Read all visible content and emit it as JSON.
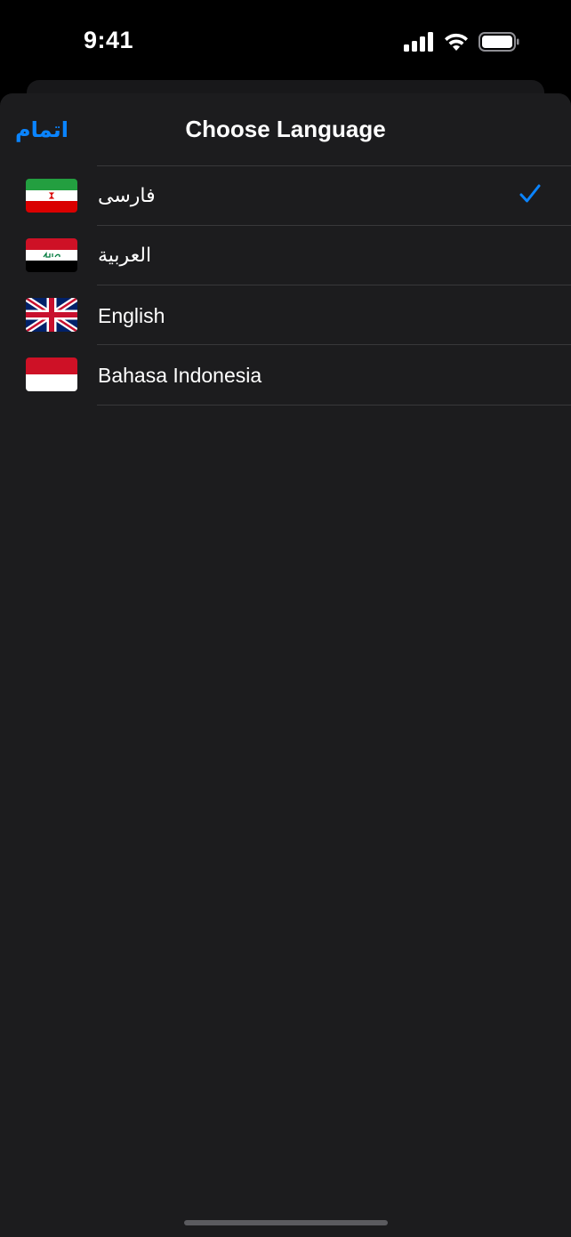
{
  "status_bar": {
    "time": "9:41",
    "icons": [
      "cellular-signal-icon",
      "wifi-icon",
      "battery-icon"
    ]
  },
  "sheet": {
    "title": "Choose Language",
    "done_label": "اتمام",
    "accent_color": "#0a84ff",
    "background_color": "#1c1c1e"
  },
  "languages": [
    {
      "label": "فارسی",
      "flag": "iran-flag-icon",
      "selected": true
    },
    {
      "label": "العربية",
      "flag": "iraq-flag-icon",
      "selected": false
    },
    {
      "label": "English",
      "flag": "uk-flag-icon",
      "selected": false
    },
    {
      "label": "Bahasa Indonesia",
      "flag": "indonesia-flag-icon",
      "selected": false
    }
  ]
}
